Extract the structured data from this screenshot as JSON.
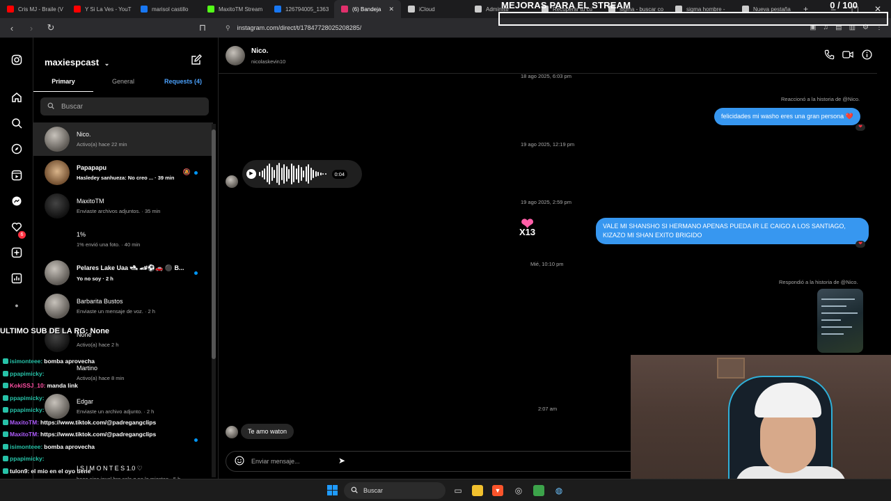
{
  "browser": {
    "tabs": [
      {
        "label": "Cris MJ - Braile (V",
        "color": "#ff0000"
      },
      {
        "label": "Y Si La Ves - YouT",
        "color": "#ff0000"
      },
      {
        "label": "marisol castillo",
        "color": "#1877f2"
      },
      {
        "label": "MaxitoTM Stream",
        "color": "#53fc18"
      },
      {
        "label": "126794005_1363",
        "color": "#1877f2"
      },
      {
        "label": "(6) Bandeja",
        "color": "#e1306c"
      },
      {
        "label": "iCloud",
        "color": "#cccccc"
      },
      {
        "label": "Administr",
        "color": "#cccccc"
      },
      {
        "label": "Recuperar tu cu",
        "color": "#cccccc"
      },
      {
        "label": "sigma - buscar co",
        "color": "#cccccc"
      },
      {
        "label": "sigma hombre - ",
        "color": "#cccccc"
      },
      {
        "label": "Nueva pestaña",
        "color": "#cccccc"
      }
    ],
    "url": "instagram.com/direct/t/17847728025208285/"
  },
  "overlay": {
    "title": "MEJORAS PARA EL STREAM",
    "count": "0 / 100",
    "last_sub": "ULTIMO SUB DE LA RG: None"
  },
  "inbox": {
    "account": "maxiespcast",
    "tab_primary": "Primary",
    "tab_general": "General",
    "tab_requests": "Requests (4)",
    "search_placeholder": "Buscar",
    "conversations": [
      {
        "name": "Nico.",
        "preview": "Activo(a) hace 22 min"
      },
      {
        "name": "Papapapu",
        "preview": "Hasledey sanhueza: No creo ... · 39 min"
      },
      {
        "name": "MaxitoTM",
        "preview": "Enviaste archivos adjuntos. · 35 min"
      },
      {
        "name": "1%",
        "preview": "1% envió una foto. · 40 min"
      },
      {
        "name": "Pelares Lake Uaa 🛥 🏎⚽🚗 ⚫ B...",
        "preview": "Yo no soy · 2 h"
      },
      {
        "name": "Barbarita Bustos",
        "preview": "Enviaste un mensaje de voz. · 2 h"
      },
      {
        "name": "None",
        "preview": "Activo(a) hace 2 h"
      },
      {
        "name": "Martino",
        "preview": "Activo(a) hace 8 min"
      },
      {
        "name": "Edgar",
        "preview": "Enviaste un archivo adjunto. · 2 h"
      },
      {
        "name": "",
        "preview": ""
      },
      {
        "name": "I S I M O N T E S 1.0 ♡",
        "preview": "boee sigo igual bro solo q no lo miesteo · 5 h"
      }
    ]
  },
  "chat": {
    "name": "Nico.",
    "username": "nicolaskevin10",
    "stamp1": "18 ago 2025, 6:03 pm",
    "reacted_note": "Reaccionó a la historia de @Nico.",
    "msg1": "felicidades mi washo eres una gran persona ❤️",
    "stamp2": "19 ago 2025, 12:19 pm",
    "voice_duration": "0:04",
    "stamp3": "19 ago 2025, 2:59 pm",
    "sticker_label": "X13",
    "msg2": "VALE MI SHANSHO SI HERMANO APENAS PUEDA IR LE CAIGO A LOS SANTIAGO, KIZAZO MI SHAN EXITO BRIGIDO",
    "stamp4": "Mié, 10:10 pm",
    "replied_note": "Respondió a la historia de @Nico.",
    "stamp5": "2:07 am",
    "msg3": "Te amo waton",
    "composer_placeholder": "Enviar mensaje..."
  },
  "stream_chat": [
    {
      "user": "isimonteee:",
      "text": "bomba aprovecha",
      "color": "#27c2a8"
    },
    {
      "user": "ppapimicky:",
      "text": "",
      "color": "#27c2a8"
    },
    {
      "user": "KokiSSJ_10:",
      "text": "manda link",
      "color": "#ff4fa3"
    },
    {
      "user": "ppapimicky:",
      "text": "",
      "color": "#27c2a8"
    },
    {
      "user": "ppapimicky:",
      "text": "",
      "color": "#27c2a8"
    },
    {
      "user": "MaxitoTM:",
      "text": "https://www.tiktok.com/@padregangclips",
      "color": "#b05cff"
    },
    {
      "user": "MaxitoTM:",
      "text": "https://www.tiktok.com/@padregangclips",
      "color": "#b05cff"
    },
    {
      "user": "isimonteee:",
      "text": "bomba aprovecha",
      "color": "#27c2a8"
    },
    {
      "user": "ppapimicky:",
      "text": "",
      "color": "#27c2a8"
    },
    {
      "user": "tulon9:",
      "text": "el mio en el oyo tiene",
      "color": "#ffffff"
    },
    {
      "user": "SYNTCO:",
      "text": "te sigho",
      "color": "#ff4fa3"
    },
    {
      "user": "isimonteee:",
      "text": "pidele la clave po",
      "color": "#27c2a8"
    }
  ],
  "taskbar": {
    "search_label": "Buscar"
  },
  "icons": {
    "instagram": "instagram-icon",
    "home": "home-icon",
    "search": "search-icon",
    "explore": "explore-icon",
    "reels": "reels-icon",
    "messages": "messages-icon",
    "notifications": "heart-icon",
    "create": "plus-icon",
    "dashboard": "dashboard-icon",
    "phone": "phone-icon",
    "video": "video-icon",
    "info": "info-icon"
  },
  "notifications_count": "6",
  "colors": {
    "accent": "#3797f0",
    "link_blue": "#4ca3ff",
    "bubble_in": "#262626",
    "background": "#000000"
  }
}
